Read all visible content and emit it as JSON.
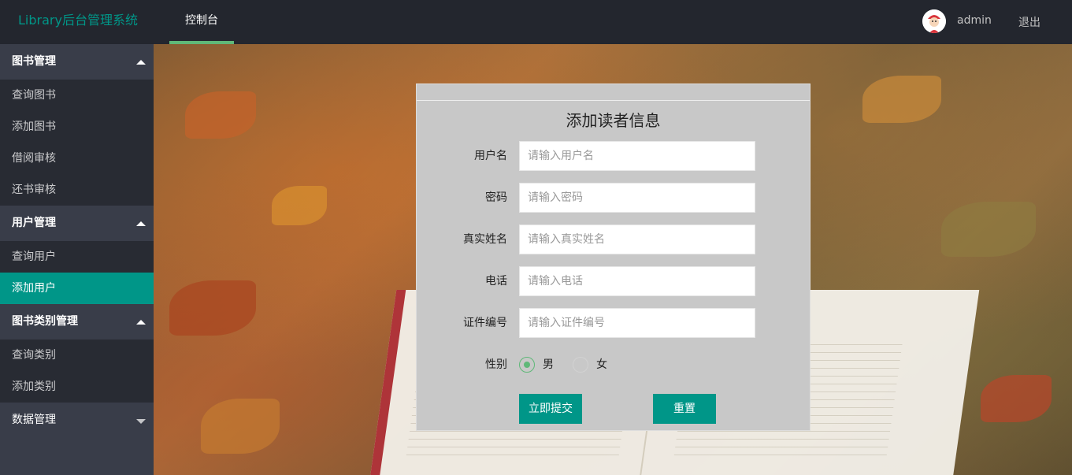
{
  "header": {
    "logo": "Library后台管理系统",
    "tab": "控制台",
    "username": "admin",
    "logout": "退出"
  },
  "sidebar": {
    "groups": [
      {
        "title": "图书管理",
        "expanded": true,
        "items": [
          "查询图书",
          "添加图书",
          "借阅审核",
          "还书审核"
        ]
      },
      {
        "title": "用户管理",
        "expanded": true,
        "items": [
          "查询用户",
          "添加用户"
        ],
        "active_item": "添加用户"
      },
      {
        "title": "图书类别管理",
        "expanded": true,
        "items": [
          "查询类别",
          "添加类别"
        ]
      },
      {
        "title": "数据管理",
        "expanded": false,
        "items": []
      }
    ]
  },
  "form": {
    "title": "添加读者信息",
    "fields": [
      {
        "label": "用户名",
        "placeholder": "请输入用户名",
        "value": ""
      },
      {
        "label": "密码",
        "placeholder": "请输入密码",
        "value": ""
      },
      {
        "label": "真实姓名",
        "placeholder": "请输入真实姓名",
        "value": ""
      },
      {
        "label": "电话",
        "placeholder": "请输入电话",
        "value": ""
      },
      {
        "label": "证件编号",
        "placeholder": "请输入证件编号",
        "value": ""
      }
    ],
    "gender": {
      "label": "性别",
      "options": [
        "男",
        "女"
      ],
      "selected": "男"
    },
    "submit_label": "立即提交",
    "reset_label": "重置"
  },
  "colors": {
    "header_bg": "#23262e",
    "sidebar_bg": "#393d49",
    "accent": "#009688",
    "radio_checked": "#5fb878"
  }
}
